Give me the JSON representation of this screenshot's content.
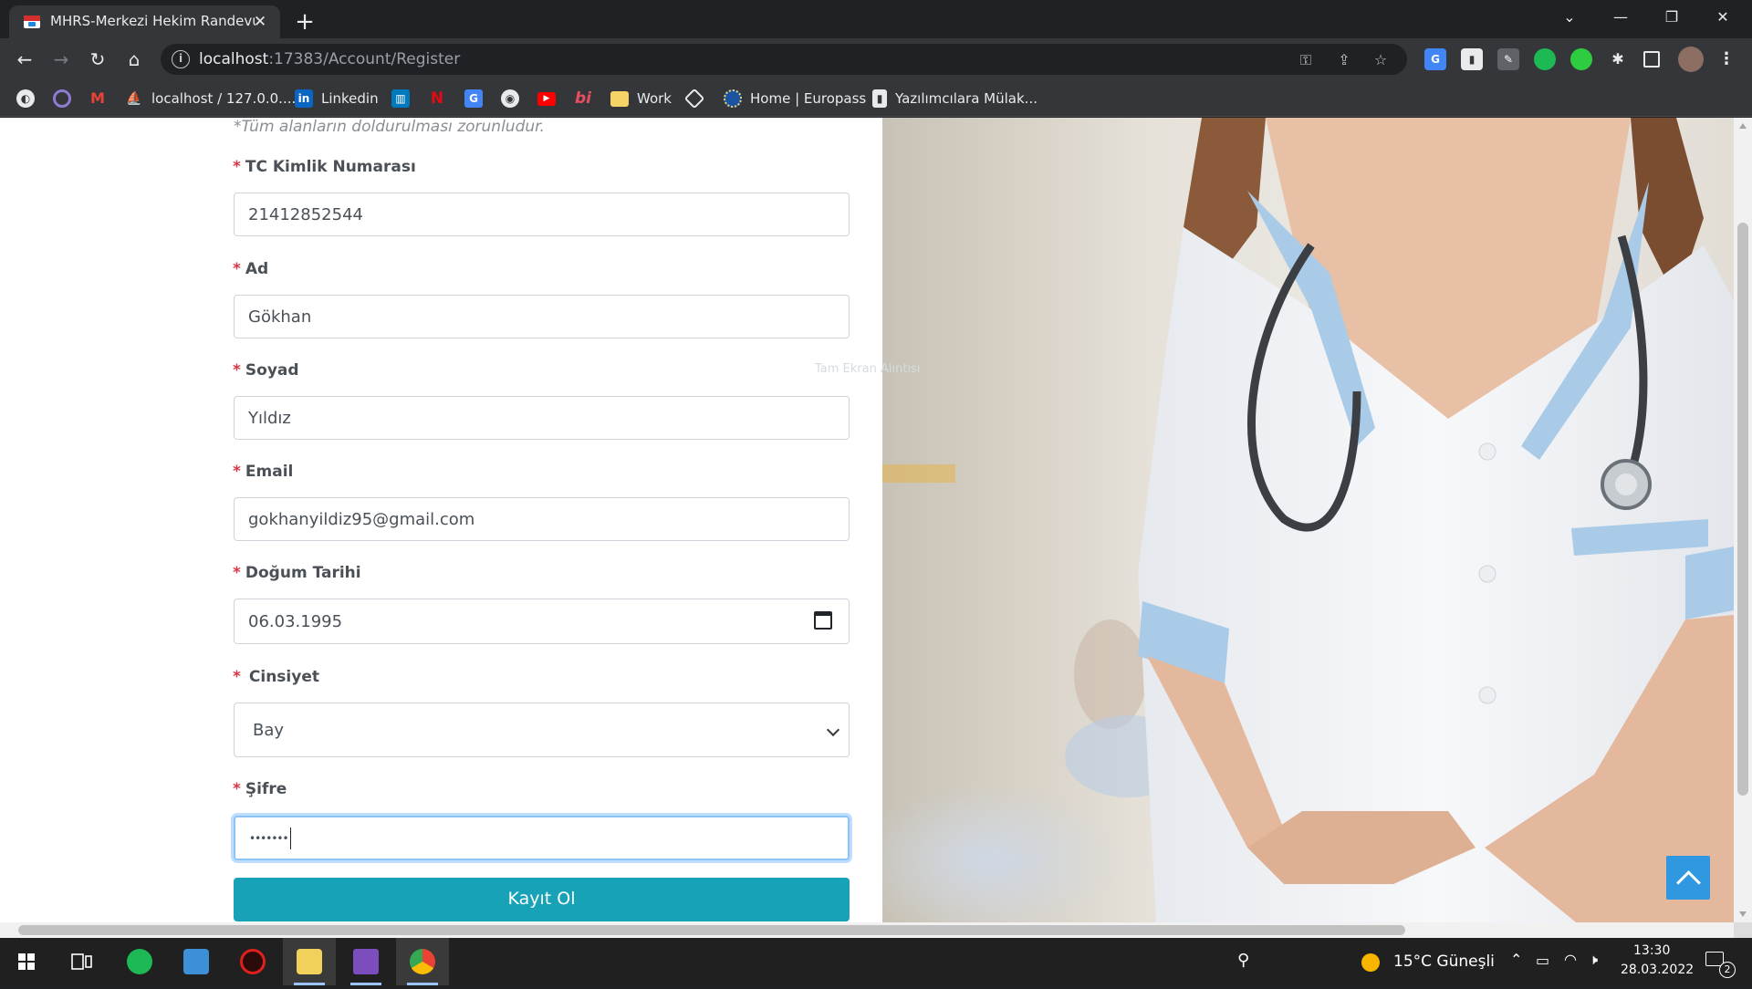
{
  "browser": {
    "tab_title": "MHRS-Merkezi Hekim Randevu S",
    "url_host": "localhost",
    "url_rest": ":17383/Account/Register",
    "bookmarks": [
      {
        "label": "",
        "icon": "ubuntu-icon",
        "color": "#e8eaed"
      },
      {
        "label": "",
        "icon": "circle-icon",
        "color": "#8f7bd1"
      },
      {
        "label": "",
        "icon": "gmail-icon",
        "color": "#ea4335"
      },
      {
        "label": "localhost / 127.0.0....",
        "icon": "phpmyadmin-icon",
        "color": "#f39c12"
      },
      {
        "label": "Linkedin",
        "icon": "linkedin-icon",
        "color": "#0a66c2"
      },
      {
        "label": "",
        "icon": "trello-icon",
        "color": "#0079bf"
      },
      {
        "label": "",
        "icon": "netflix-icon",
        "color": "#e50914"
      },
      {
        "label": "",
        "icon": "translate-icon",
        "color": "#4285f4"
      },
      {
        "label": "",
        "icon": "github-icon",
        "color": "#e8eaed"
      },
      {
        "label": "",
        "icon": "youtube-icon",
        "color": "#ff0000"
      },
      {
        "label": "",
        "icon": "bi-icon",
        "color": "#e94e5e"
      },
      {
        "label": "Work",
        "icon": "folder-icon",
        "color": "#f6d365"
      },
      {
        "label": "",
        "icon": "codepen-icon",
        "color": "#e8eaed"
      },
      {
        "label": "Home | Europass",
        "icon": "europass-icon",
        "color": "#1a53a0"
      },
      {
        "label": "Yazılımcılara Mülak...",
        "icon": "page-icon",
        "color": "#e8eaed"
      }
    ]
  },
  "form": {
    "required_note": "*Tüm alanların doldurulması zorunludur.",
    "star": "*",
    "fields": {
      "tc": {
        "label": "TC Kimlik Numarası",
        "value": "21412852544"
      },
      "ad": {
        "label": "Ad",
        "value": "Gökhan"
      },
      "soyad": {
        "label": "Soyad",
        "value": "Yıldız"
      },
      "email": {
        "label": "Email",
        "value": "gokhanyildiz95@gmail.com"
      },
      "dogum": {
        "label": "Doğum Tarihi",
        "value": "06.03.1995"
      },
      "cinsiyet": {
        "label": "Cinsiyet",
        "value": "Bay"
      },
      "sifre": {
        "label": "Şifre",
        "value": "•••••••"
      }
    },
    "submit_label": "Kayıt Ol"
  },
  "hero": {
    "ghost_text": "Tam Ekran Alıntısı"
  },
  "taskbar": {
    "weather": "15°C Güneşli",
    "time": "13:30",
    "date": "28.03.2022",
    "notification_count": "2"
  }
}
